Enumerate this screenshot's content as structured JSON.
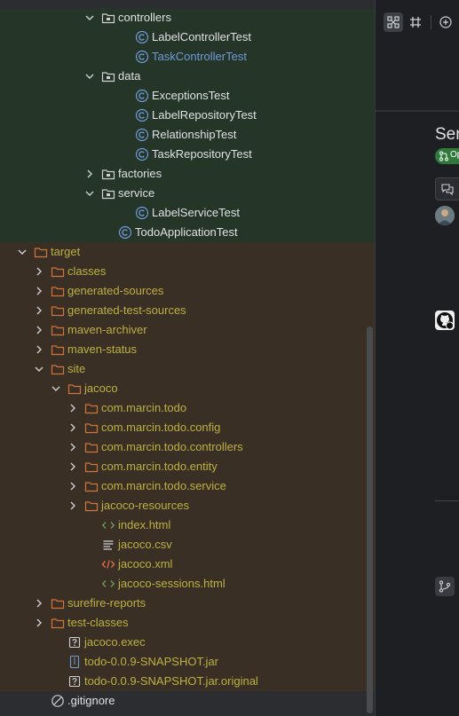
{
  "tree": [
    {
      "label": "controllers",
      "type": "package",
      "state": "open",
      "level": 5,
      "bg": "green",
      "color": "default"
    },
    {
      "label": "LabelControllerTest",
      "type": "class",
      "level": 7,
      "bg": "green",
      "color": "default"
    },
    {
      "label": "TaskControllerTest",
      "type": "class",
      "level": 7,
      "bg": "green",
      "color": "blue"
    },
    {
      "label": "data",
      "type": "package",
      "state": "open",
      "level": 5,
      "bg": "green",
      "color": "default"
    },
    {
      "label": "ExceptionsTest",
      "type": "class",
      "level": 7,
      "bg": "green",
      "color": "default"
    },
    {
      "label": "LabelRepositoryTest",
      "type": "class",
      "level": 7,
      "bg": "green",
      "color": "default"
    },
    {
      "label": "RelationshipTest",
      "type": "class",
      "level": 7,
      "bg": "green",
      "color": "default"
    },
    {
      "label": "TaskRepositoryTest",
      "type": "class",
      "level": 7,
      "bg": "green",
      "color": "default"
    },
    {
      "label": "factories",
      "type": "package",
      "state": "closed",
      "level": 5,
      "bg": "green",
      "color": "default"
    },
    {
      "label": "service",
      "type": "package",
      "state": "open",
      "level": 5,
      "bg": "green",
      "color": "default"
    },
    {
      "label": "LabelServiceTest",
      "type": "class",
      "level": 7,
      "bg": "green",
      "color": "default"
    },
    {
      "label": "TodoApplicationTest",
      "type": "class",
      "level": 6,
      "bg": "green",
      "color": "default"
    },
    {
      "label": "target",
      "type": "folder",
      "state": "open",
      "level": 1,
      "bg": "brown",
      "color": "olive"
    },
    {
      "label": "classes",
      "type": "folder",
      "state": "closed",
      "level": 2,
      "bg": "brown",
      "color": "olive"
    },
    {
      "label": "generated-sources",
      "type": "folder",
      "state": "closed",
      "level": 2,
      "bg": "brown",
      "color": "olive"
    },
    {
      "label": "generated-test-sources",
      "type": "folder",
      "state": "closed",
      "level": 2,
      "bg": "brown",
      "color": "olive"
    },
    {
      "label": "maven-archiver",
      "type": "folder",
      "state": "closed",
      "level": 2,
      "bg": "brown",
      "color": "olive"
    },
    {
      "label": "maven-status",
      "type": "folder",
      "state": "closed",
      "level": 2,
      "bg": "brown",
      "color": "olive"
    },
    {
      "label": "site",
      "type": "folder",
      "state": "open",
      "level": 2,
      "bg": "brown",
      "color": "olive"
    },
    {
      "label": "jacoco",
      "type": "folder",
      "state": "open",
      "level": 3,
      "bg": "brown",
      "color": "olive"
    },
    {
      "label": "com.marcin.todo",
      "type": "folder",
      "state": "closed",
      "level": 4,
      "bg": "brown",
      "color": "olive"
    },
    {
      "label": "com.marcin.todo.config",
      "type": "folder",
      "state": "closed",
      "level": 4,
      "bg": "brown",
      "color": "olive"
    },
    {
      "label": "com.marcin.todo.controllers",
      "type": "folder",
      "state": "closed",
      "level": 4,
      "bg": "brown",
      "color": "olive"
    },
    {
      "label": "com.marcin.todo.entity",
      "type": "folder",
      "state": "closed",
      "level": 4,
      "bg": "brown",
      "color": "olive"
    },
    {
      "label": "com.marcin.todo.service",
      "type": "folder",
      "state": "closed",
      "level": 4,
      "bg": "brown",
      "color": "olive"
    },
    {
      "label": "jacoco-resources",
      "type": "folder",
      "state": "closed",
      "level": 4,
      "bg": "brown",
      "color": "olive"
    },
    {
      "label": "index.html",
      "type": "html",
      "level": 5,
      "bg": "brown",
      "color": "olive"
    },
    {
      "label": "jacoco.csv",
      "type": "text",
      "level": 5,
      "bg": "brown",
      "color": "olive"
    },
    {
      "label": "jacoco.xml",
      "type": "xml",
      "level": 5,
      "bg": "brown",
      "color": "olive"
    },
    {
      "label": "jacoco-sessions.html",
      "type": "html",
      "level": 5,
      "bg": "brown",
      "color": "olive"
    },
    {
      "label": "surefire-reports",
      "type": "folder",
      "state": "closed",
      "level": 2,
      "bg": "brown",
      "color": "olive"
    },
    {
      "label": "test-classes",
      "type": "folder",
      "state": "closed",
      "level": 2,
      "bg": "brown",
      "color": "olive"
    },
    {
      "label": "jacoco.exec",
      "type": "unknown",
      "level": 3,
      "bg": "brown",
      "color": "olive"
    },
    {
      "label": "todo-0.0.9-SNAPSHOT.jar",
      "type": "jar",
      "level": 3,
      "bg": "brown",
      "color": "olive"
    },
    {
      "label": "todo-0.0.9-SNAPSHOT.jar.original",
      "type": "unknown",
      "level": 3,
      "bg": "brown",
      "color": "olive"
    },
    {
      "label": ".gitignore",
      "type": "ignore",
      "level": 2,
      "bg": "plain",
      "color": "default"
    }
  ],
  "right_panel": {
    "heading": "Ser",
    "badge": "Op",
    "icons": [
      "diagram-icon",
      "frame-icon",
      "add-icon",
      "chat-icon",
      "avatar",
      "github-icon",
      "branch-icon"
    ]
  },
  "colors": {
    "tree_bg": "#2b2d30",
    "test_bg": "#253528",
    "excluded_bg": "#3a2f25",
    "olive_text": "#bcb042",
    "blue_text": "#6f9bd8",
    "default_text": "#dfe1e5",
    "class_icon": "#6f9bd8",
    "folder_icon": "#d0743c",
    "badge_green": "#2f7a3a"
  }
}
